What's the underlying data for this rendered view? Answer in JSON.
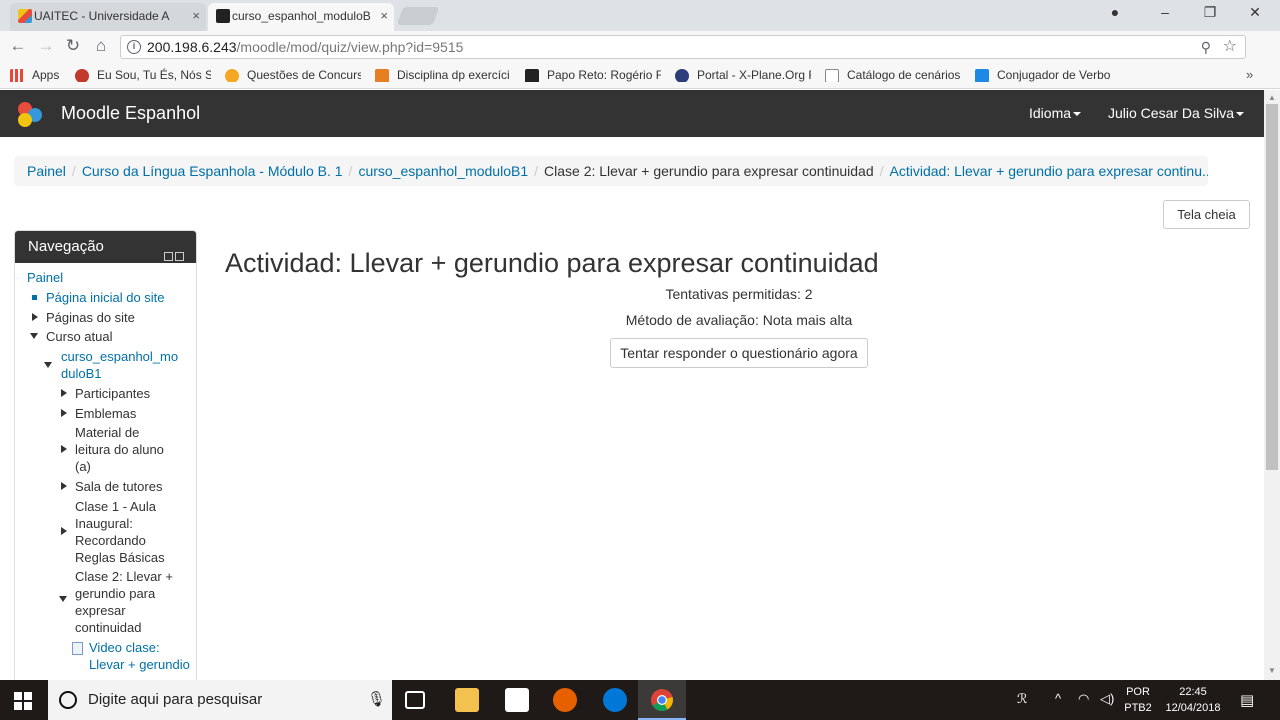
{
  "browser": {
    "tabs": [
      {
        "title": "UAITEC - Universidade A",
        "close": "×"
      },
      {
        "title": "curso_espanhol_moduloB",
        "close": "×"
      }
    ],
    "window_controls": {
      "minimize": "–",
      "restore": "❐",
      "close": "✕"
    },
    "nav": {
      "back": "←",
      "forward": "→",
      "reload": "↻",
      "home": "⌂"
    },
    "url_host": "200.198.6.243",
    "url_path": "/moodle/mod/quiz/view.php?id=9515",
    "bookmarks": [
      {
        "label": "Apps",
        "color": "#e8453c"
      },
      {
        "label": "Eu Sou, Tu És, Nós So",
        "color": "#c0392b"
      },
      {
        "label": "Questões de Concurs",
        "color": "#f5a623"
      },
      {
        "label": "Disciplina dp exercíci",
        "color": "#e67e22"
      },
      {
        "label": "Papo Reto: Rogério F",
        "color": "#222222"
      },
      {
        "label": "Portal - X-Plane.Org F",
        "color": "#2c3e7a"
      },
      {
        "label": "Catálogo de cenários",
        "color": "#888888"
      },
      {
        "label": "Conjugador de Verbo",
        "color": "#1e88e5"
      }
    ]
  },
  "moodle": {
    "brand": "Moodle Espanhol",
    "language_menu": "Idioma",
    "user_menu": "Julio Cesar Da Silva",
    "breadcrumb": [
      {
        "label": "Painel",
        "link": true
      },
      {
        "label": "Curso da Língua Espanhola - Módulo B. 1",
        "link": true
      },
      {
        "label": "curso_espanhol_moduloB1",
        "link": true
      },
      {
        "label": "Clase 2: Llevar + gerundio para expresar continuidad",
        "link": false
      },
      {
        "label": "Actividad: Llevar + gerundio para expresar continu...",
        "link": true
      }
    ],
    "fullscreen_button": "Tela cheia",
    "navigation": {
      "title": "Navegação",
      "painel": "Painel",
      "site_home": "Página inicial do site",
      "site_pages": "Páginas do site",
      "current_course": "Curso atual",
      "course_line1": "curso_espanhol_mo",
      "course_line2": "duloB1",
      "participants": "Participantes",
      "badges": "Emblemas",
      "material_l1": "Material de",
      "material_l2": "leitura do aluno",
      "material_l3": "(a)",
      "tutors": "Sala de tutores",
      "clase1_l1": "Clase 1 - Aula",
      "clase1_l2": "Inaugural:",
      "clase1_l3": "Recordando",
      "clase1_l4": "Reglas Básicas",
      "clase2_l1": "Clase 2: Llevar +",
      "clase2_l2": "gerundio para",
      "clase2_l3": "expresar",
      "clase2_l4": "continuidad",
      "video_l1": "Video clase:",
      "video_l2": "Llevar + gerundio"
    },
    "main": {
      "title": "Actividad: Llevar + gerundio para expresar continuidad",
      "attempts": "Tentativas permitidas: 2",
      "grading": "Método de avaliação: Nota mais alta",
      "attempt_button": "Tentar responder o questionário agora"
    }
  },
  "taskbar": {
    "search_placeholder": "Digite aqui para pesquisar",
    "language": "POR",
    "layout": "PTB2",
    "time": "22:45",
    "date": "12/04/2018"
  }
}
